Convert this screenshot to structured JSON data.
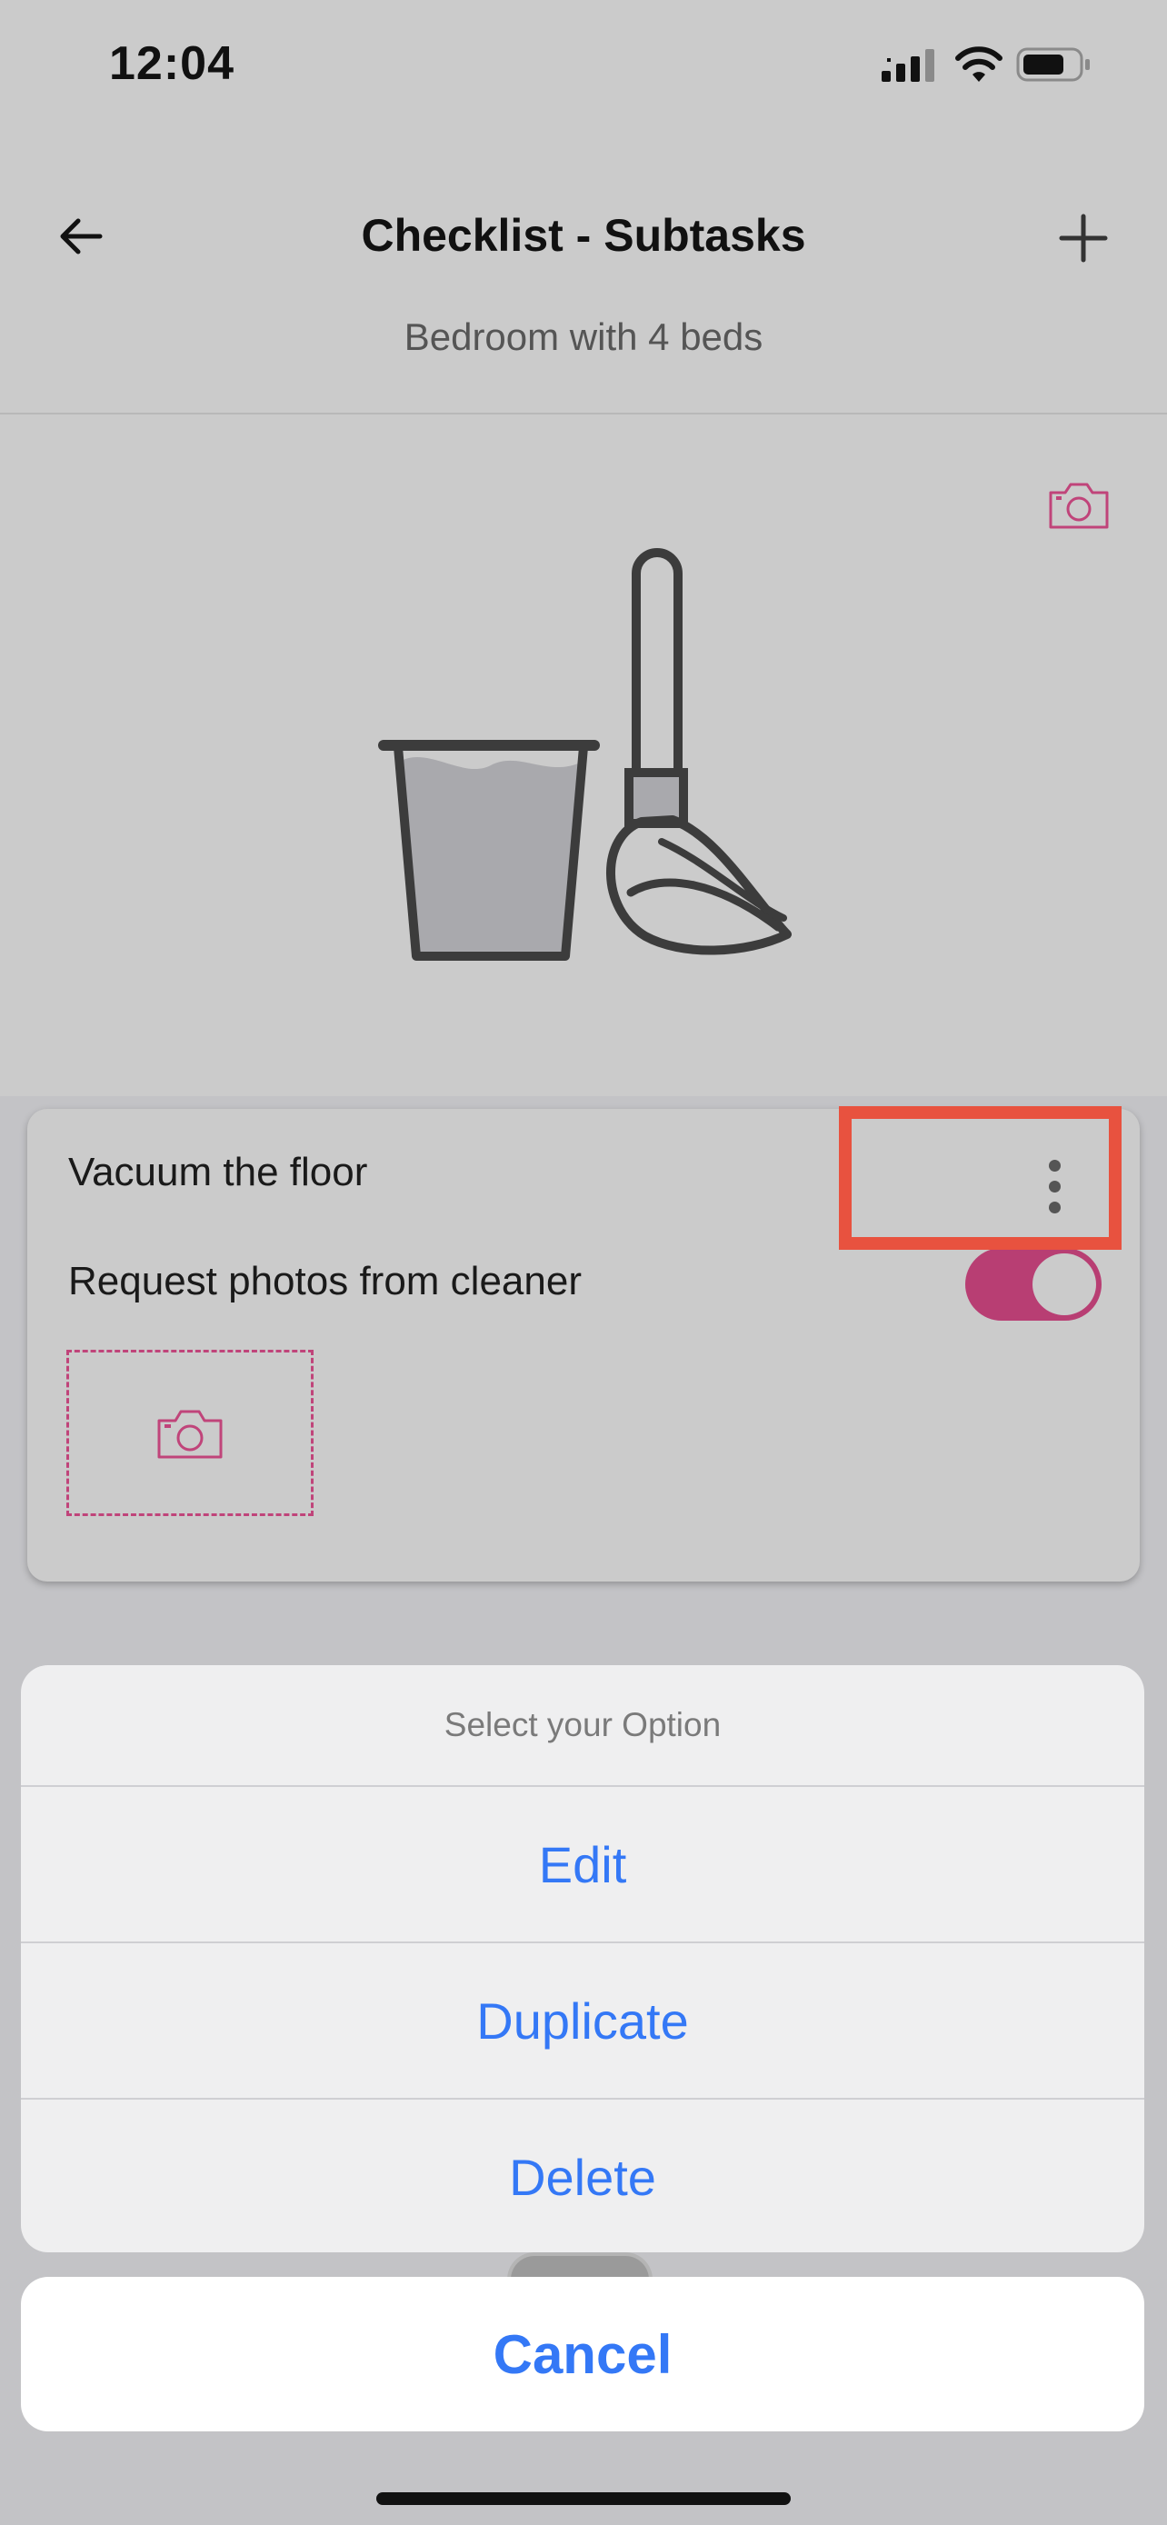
{
  "status_bar": {
    "time": "12:04"
  },
  "header": {
    "title": "Checklist - Subtasks",
    "subtitle": "Bedroom with 4 beds",
    "back_icon": "arrow-left-icon",
    "add_icon": "plus-icon"
  },
  "task_card": {
    "title": "Vacuum the floor",
    "request_photos_label": "Request photos from cleaner",
    "request_photos_enabled": true,
    "more_icon": "more-vertical-icon"
  },
  "action_sheet": {
    "header": "Select your Option",
    "options": [
      "Edit",
      "Duplicate",
      "Delete"
    ],
    "cancel": "Cancel"
  },
  "colors": {
    "accent": "#b83e73",
    "ios_blue": "#3478f6",
    "highlight": "#e8523f"
  }
}
